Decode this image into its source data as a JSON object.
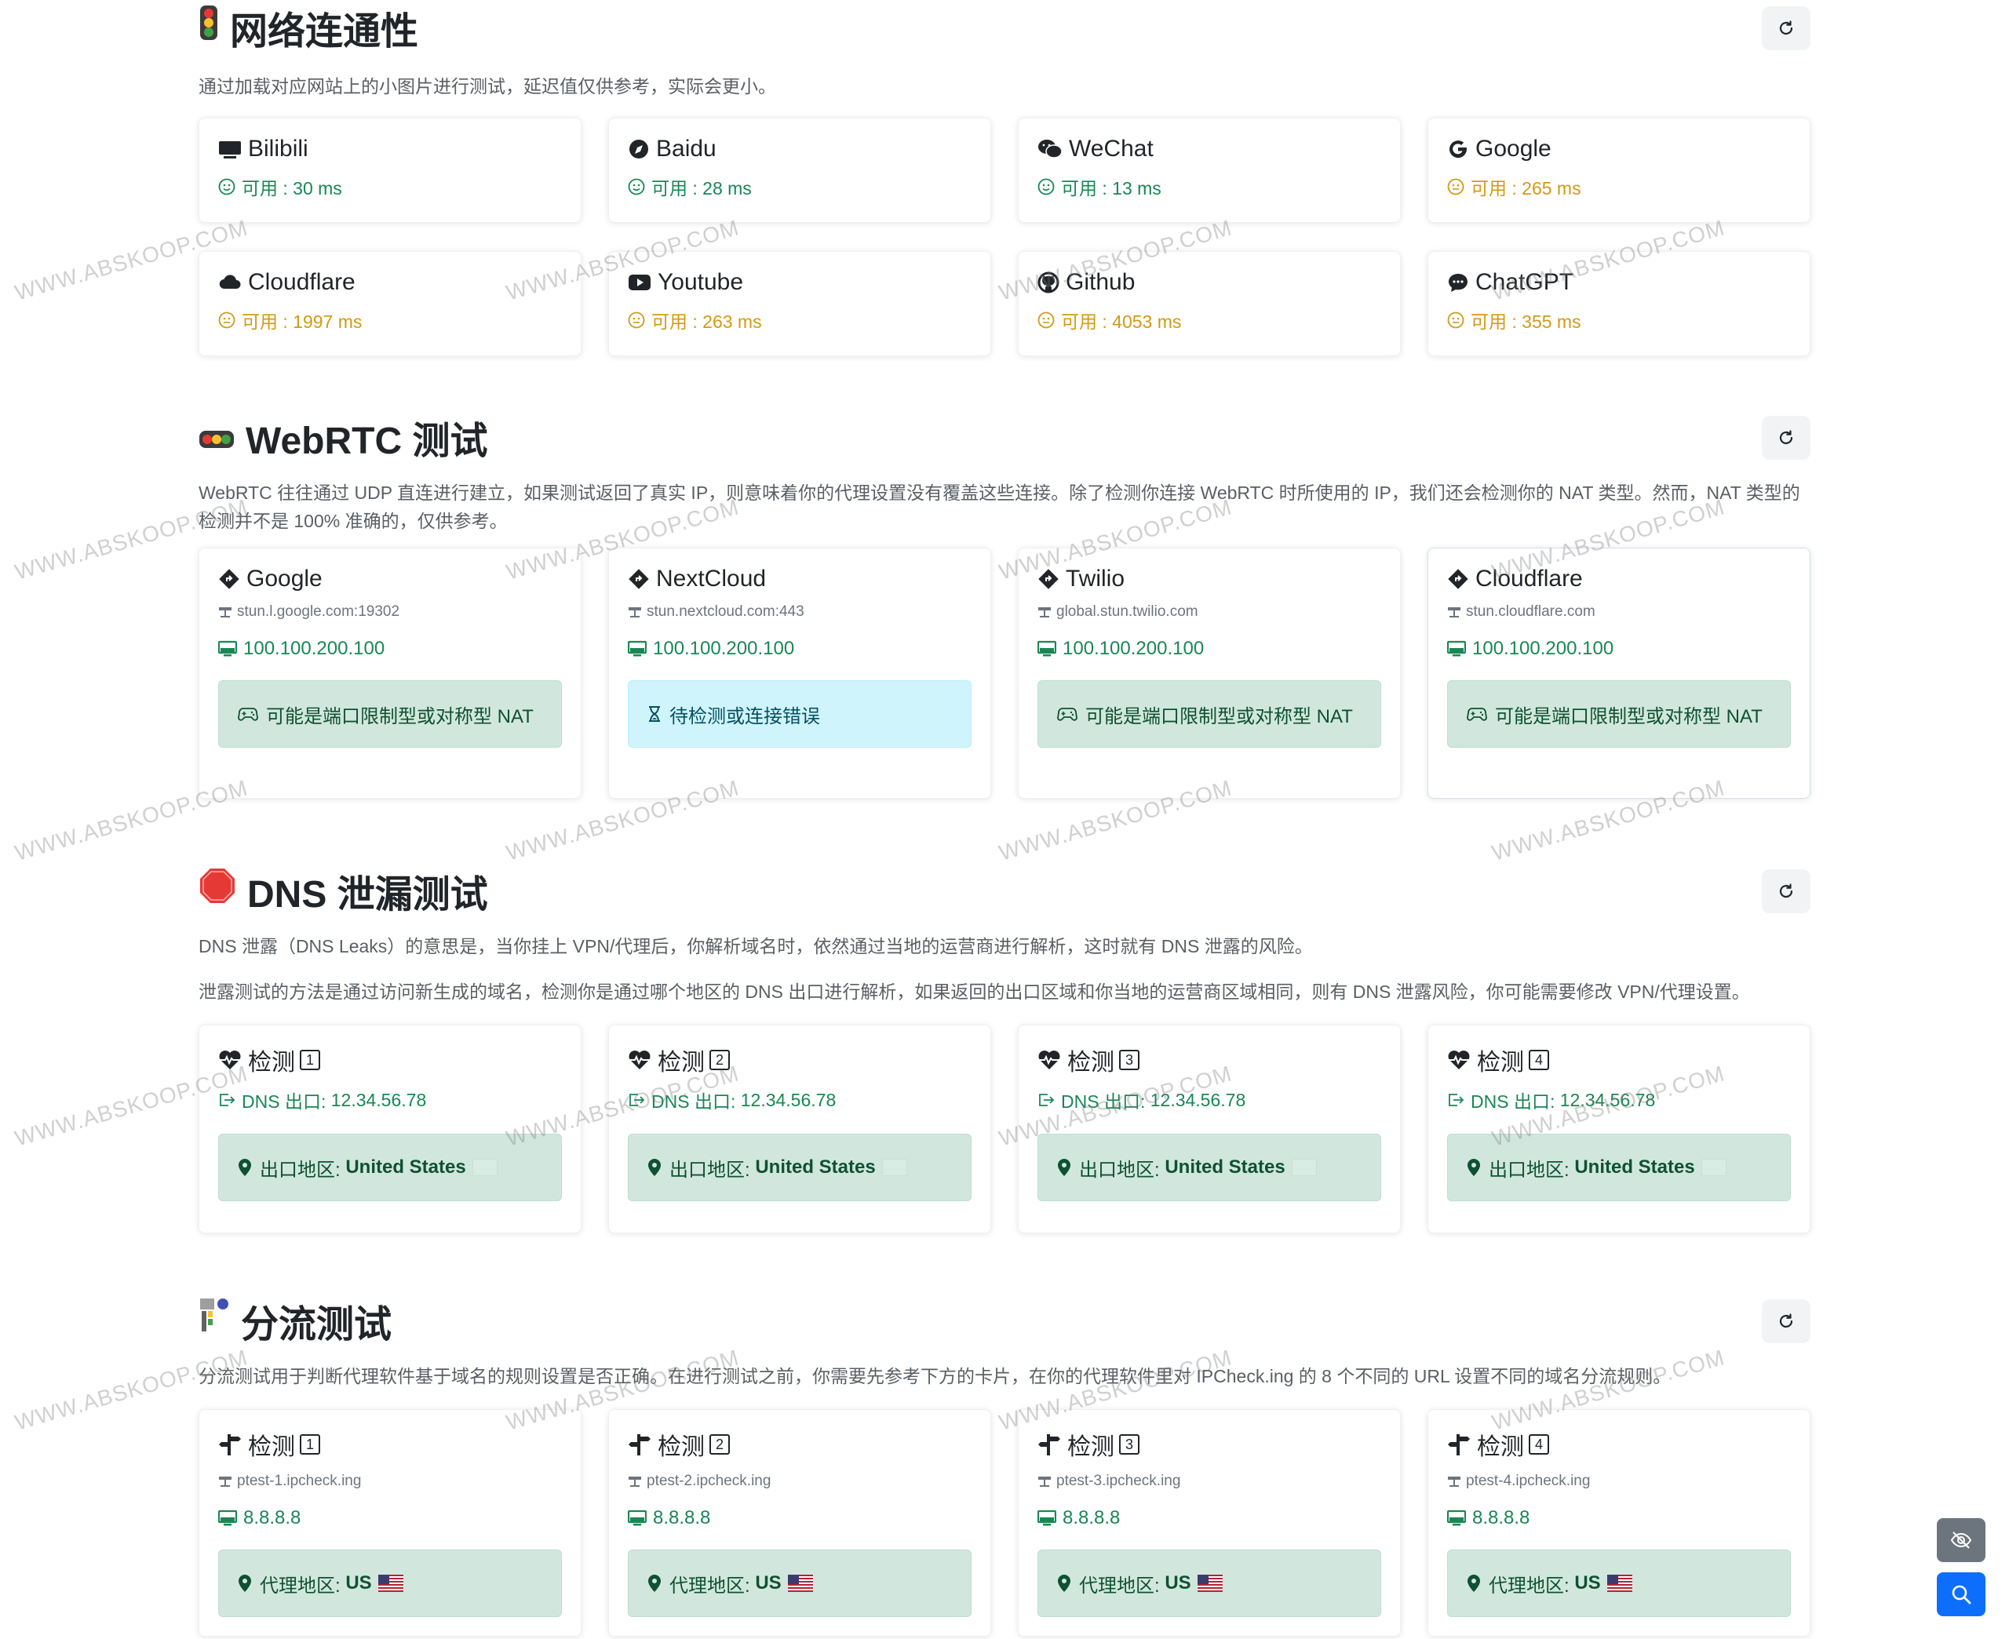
{
  "connectivity": {
    "title": "网络连通性",
    "icon": "traffic-light-icon",
    "description": "通过加载对应网站上的小图片进行测试，延迟值仅供参考，实际会更小。",
    "sites": [
      {
        "name": "Bilibili",
        "icon": "tv-icon",
        "status": "可用 : 30 ms",
        "level": "good"
      },
      {
        "name": "Baidu",
        "icon": "compass-icon",
        "status": "可用 : 28 ms",
        "level": "good"
      },
      {
        "name": "WeChat",
        "icon": "wechat-icon",
        "status": "可用 : 13 ms",
        "level": "good"
      },
      {
        "name": "Google",
        "icon": "google-icon",
        "status": "可用 : 265 ms",
        "level": "medium"
      },
      {
        "name": "Cloudflare",
        "icon": "cloud-icon",
        "status": "可用 : 1997 ms",
        "level": "medium"
      },
      {
        "name": "Youtube",
        "icon": "youtube-icon",
        "status": "可用 : 263 ms",
        "level": "medium"
      },
      {
        "name": "Github",
        "icon": "github-icon",
        "status": "可用 : 4053 ms",
        "level": "medium"
      },
      {
        "name": "ChatGPT",
        "icon": "chat-icon",
        "status": "可用 : 355 ms",
        "level": "medium"
      }
    ]
  },
  "webrtc": {
    "title": "WebRTC 测试",
    "icon": "webrtc-lights-icon",
    "description": "WebRTC 往往通过 UDP 直连进行建立，如果测试返回了真实 IP，则意味着你的代理设置没有覆盖这些连接。除了检测你连接 WebRTC 时所使用的 IP，我们还会检测你的 NAT 类型。然而，NAT 类型的检测并不是 100% 准确的，仅供参考。",
    "servers": [
      {
        "name": "Google",
        "host": "stun.l.google.com:19302",
        "ip": "100.100.200.100",
        "result": "可能是端口限制型或对称型 NAT",
        "state": "done"
      },
      {
        "name": "NextCloud",
        "host": "stun.nextcloud.com:443",
        "ip": "100.100.200.100",
        "result": "待检测或连接错误",
        "state": "pending"
      },
      {
        "name": "Twilio",
        "host": "global.stun.twilio.com",
        "ip": "100.100.200.100",
        "result": "可能是端口限制型或对称型 NAT",
        "state": "done"
      },
      {
        "name": "Cloudflare",
        "host": "stun.cloudflare.com",
        "ip": "100.100.200.100",
        "result": "可能是端口限制型或对称型 NAT",
        "state": "done"
      }
    ]
  },
  "dns": {
    "title": "DNS 泄漏测试",
    "icon": "stop-sign-icon",
    "description1": "DNS 泄露（DNS Leaks）的意思是，当你挂上 VPN/代理后，你解析域名时，依然通过当地的运营商进行解析，这时就有 DNS 泄露的风险。",
    "description2": "泄露测试的方法是通过访问新生成的域名，检测你是通过哪个地区的 DNS 出口进行解析，如果返回的出口区域和你当地的运营商区域相同，则有 DNS 泄露风险，你可能需要修改 VPN/代理设置。",
    "test_label": "检测",
    "exit_prefix": "DNS 出口:",
    "region_prefix": "出口地区:",
    "tests": [
      {
        "num": "1",
        "exit": "12.34.56.78",
        "region": "United States"
      },
      {
        "num": "2",
        "exit": "12.34.56.78",
        "region": "United States"
      },
      {
        "num": "3",
        "exit": "12.34.56.78",
        "region": "United States"
      },
      {
        "num": "4",
        "exit": "12.34.56.78",
        "region": "United States"
      }
    ]
  },
  "split": {
    "title": "分流测试",
    "icon": "split-panel-icon",
    "description": "分流测试用于判断代理软件基于域名的规则设置是否正确。在进行测试之前，你需要先参考下方的卡片，在你的代理软件里对 IPCheck.ing 的 8 个不同的 URL 设置不同的域名分流规则。",
    "test_label": "检测",
    "region_prefix": "代理地区:",
    "tests": [
      {
        "num": "1",
        "host": "ptest-1.ipcheck.ing",
        "ip": "8.8.8.8",
        "region": "US"
      },
      {
        "num": "2",
        "host": "ptest-2.ipcheck.ing",
        "ip": "8.8.8.8",
        "region": "US"
      },
      {
        "num": "3",
        "host": "ptest-3.ipcheck.ing",
        "ip": "8.8.8.8",
        "region": "US"
      },
      {
        "num": "4",
        "host": "ptest-4.ipcheck.ing",
        "ip": "8.8.8.8",
        "region": "US"
      }
    ]
  },
  "watermark": "WWW.ABSKOOP.COM",
  "colors": {
    "good": "#198754",
    "medium": "#d29a14",
    "alert_green": "#d1e7dd",
    "alert_blue": "#cff4fc",
    "primary": "#0d6efd"
  }
}
